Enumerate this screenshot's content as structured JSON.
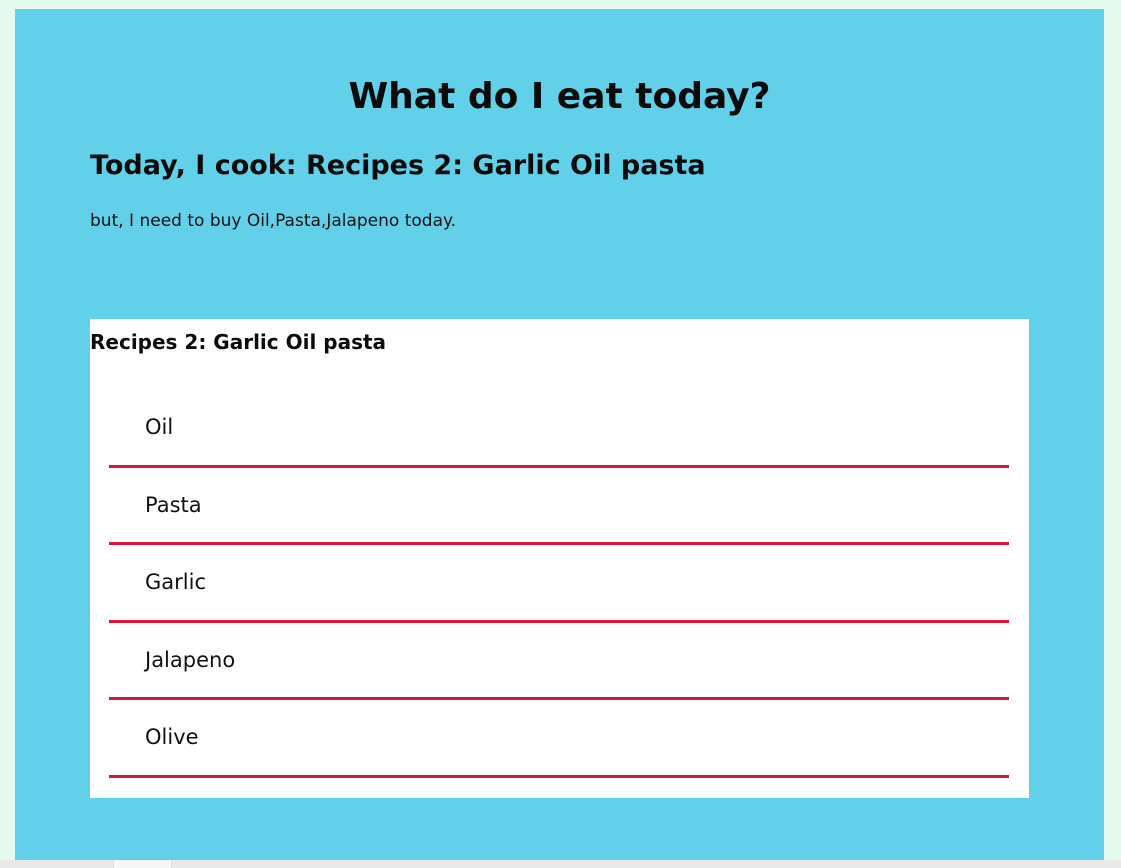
{
  "page": {
    "title": "What do I eat today?",
    "today_heading": "Today, I cook: Recipes 2: Garlic Oil pasta",
    "buy_line": "but, I need to buy Oil,Pasta,Jalapeno today."
  },
  "recipe": {
    "title": "Recipes 2: Garlic Oil pasta",
    "ingredients": [
      "Oil",
      "Pasta",
      "Garlic",
      "Jalapeno",
      "Olive"
    ]
  },
  "colors": {
    "page_background": "#e6fbef",
    "panel_background": "#61d0e8",
    "card_background": "#ffffff",
    "divider": "#d8163c"
  }
}
